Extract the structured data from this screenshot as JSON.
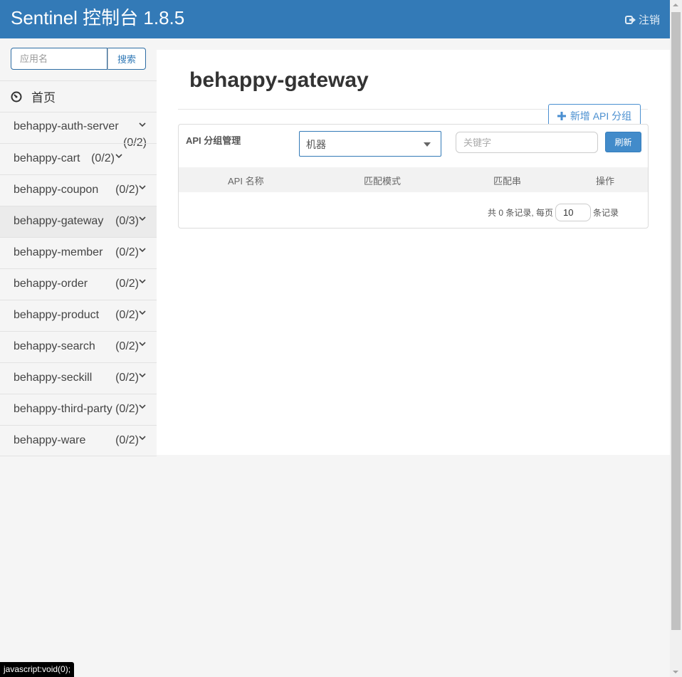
{
  "header": {
    "title": "Sentinel 控制台 1.8.5",
    "logout_label": "注销"
  },
  "sidebar": {
    "search": {
      "placeholder": "应用名",
      "button_label": "搜索"
    },
    "home_label": "首页",
    "apps": [
      {
        "name": "behappy-auth-server",
        "count": "(0/2)"
      },
      {
        "name": "behappy-cart",
        "count": "(0/2)"
      },
      {
        "name": "behappy-coupon",
        "count": "(0/2)"
      },
      {
        "name": "behappy-gateway",
        "count": "(0/3)"
      },
      {
        "name": "behappy-member",
        "count": "(0/2)"
      },
      {
        "name": "behappy-order",
        "count": "(0/2)"
      },
      {
        "name": "behappy-product",
        "count": "(0/2)"
      },
      {
        "name": "behappy-search",
        "count": "(0/2)"
      },
      {
        "name": "behappy-seckill",
        "count": "(0/2)"
      },
      {
        "name": "behappy-third-party",
        "count": "(0/2)"
      },
      {
        "name": "behappy-ware",
        "count": "(0/2)"
      }
    ],
    "active_app": "behappy-gateway"
  },
  "main": {
    "title": "behappy-gateway",
    "add_button_label": "新增 API 分组",
    "panel": {
      "label": "API 分组管理",
      "machine_select_value": "机器",
      "keyword_placeholder": "关键字",
      "refresh_label": "刷新",
      "columns": [
        "API 名称",
        "匹配模式",
        "匹配串",
        "操作"
      ],
      "rows": [],
      "pager": {
        "prefix": "共 0 条记录, 每页",
        "page_size": "10",
        "suffix": "条记录"
      }
    }
  },
  "statusbar": {
    "text": "javascript:void(0);"
  },
  "colors": {
    "header_bg": "#337ab7",
    "primary": "#428bca",
    "sidebar_bg": "#f5f5f5",
    "active_item_bg": "#ebebeb"
  }
}
